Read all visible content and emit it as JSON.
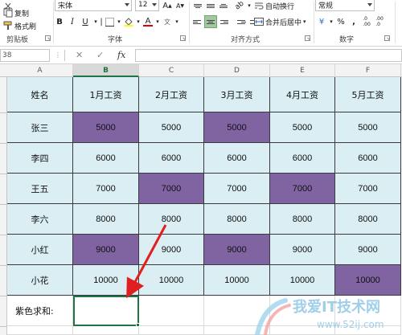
{
  "ribbon": {
    "clipboard": {
      "cut_label": "",
      "copy_label": "复制",
      "format_painter_label": "格式刷",
      "group_label": "剪贴板"
    },
    "font": {
      "font_name": "宋体",
      "font_size": "12",
      "bold": "B",
      "italic": "I",
      "underline": "U",
      "font_color_letter": "A",
      "group_label": "字体"
    },
    "alignment": {
      "wrap_text_label": "自动换行",
      "merge_center_label": "合并后居中",
      "group_label": "对齐方式"
    },
    "number": {
      "format_value": "常规",
      "percent": "%",
      "comma": ",",
      "group_label": "数字"
    },
    "colors": {
      "accent_green": "#217346",
      "font_color_red": "#e00000",
      "highlight_yellow": "#ffff00"
    }
  },
  "formula_bar": {
    "name_box": "38",
    "cancel_icon": "✕",
    "enter_icon": "✓",
    "fx_label": "fx",
    "value": ""
  },
  "sheet": {
    "columns": [
      "A",
      "B",
      "C",
      "D",
      "E",
      "F"
    ],
    "selected_column": "B",
    "header_row": [
      "姓名",
      "1月工资",
      "2月工资",
      "3月工资",
      "4月工资",
      "5月工资"
    ],
    "rows": [
      {
        "name": "张三",
        "values": [
          "5000",
          "5000",
          "5000",
          "5000",
          "5000"
        ],
        "purple": [
          true,
          false,
          true,
          false,
          false
        ]
      },
      {
        "name": "李四",
        "values": [
          "6000",
          "6000",
          "6000",
          "6000",
          "6000"
        ],
        "purple": [
          false,
          false,
          false,
          false,
          false
        ]
      },
      {
        "name": "王五",
        "values": [
          "7000",
          "7000",
          "7000",
          "7000",
          "7000"
        ],
        "purple": [
          false,
          true,
          false,
          true,
          false
        ]
      },
      {
        "name": "李六",
        "values": [
          "8000",
          "8000",
          "8000",
          "8000",
          "8000"
        ],
        "purple": [
          false,
          false,
          false,
          false,
          false
        ]
      },
      {
        "name": "小红",
        "values": [
          "9000",
          "9000",
          "9000",
          "9000",
          "9000"
        ],
        "purple": [
          true,
          false,
          true,
          false,
          false
        ]
      },
      {
        "name": "小花",
        "values": [
          "10000",
          "10000",
          "10000",
          "10000",
          "10000"
        ],
        "purple": [
          false,
          false,
          false,
          false,
          true
        ]
      }
    ],
    "sum_label": "紫色求和:",
    "sum_value": "",
    "colors": {
      "table_fill": "#daeef3",
      "highlight_purple": "#8064a2",
      "arrow_red": "#e02020"
    }
  },
  "watermark": {
    "text": "我爱IT技术网",
    "url": "www.52ij.com"
  }
}
